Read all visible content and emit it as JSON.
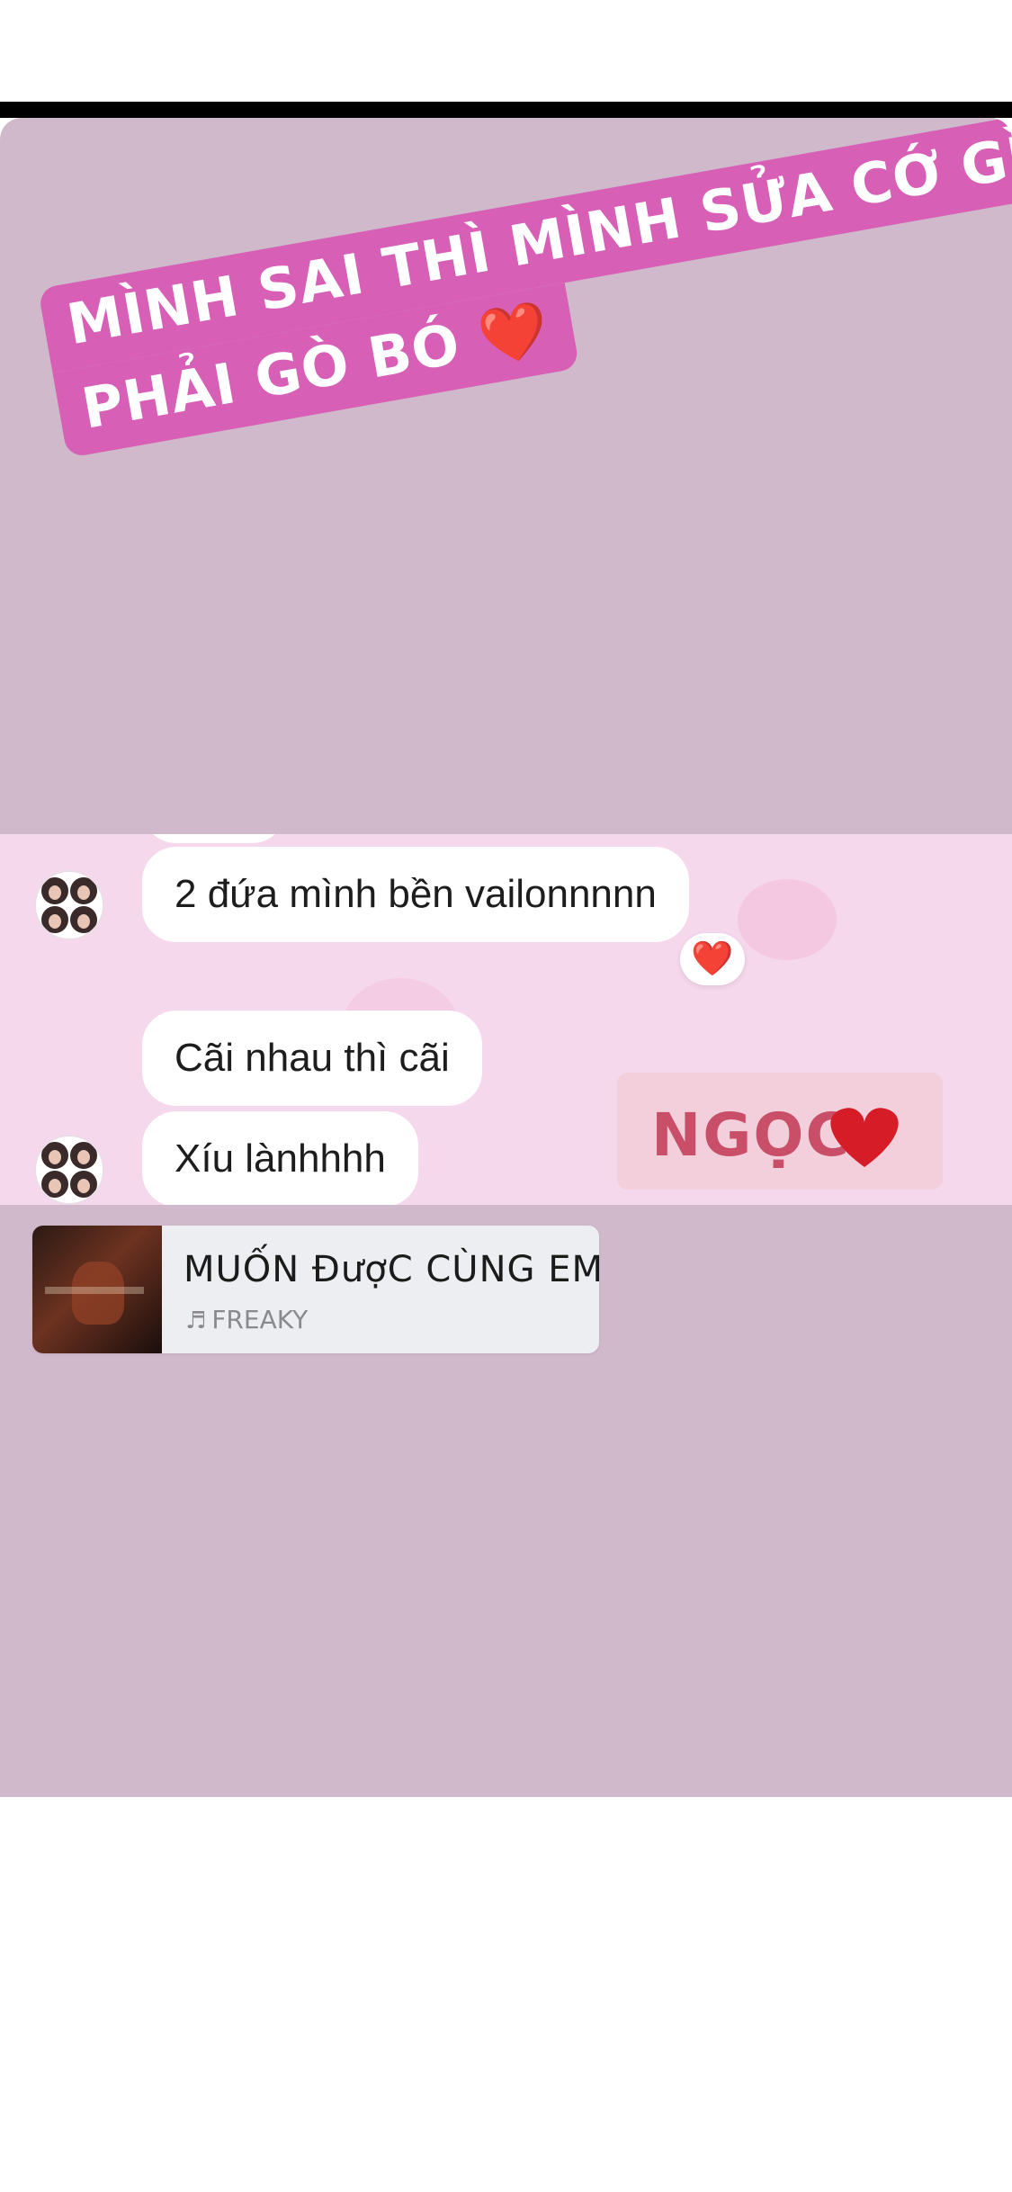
{
  "story": {
    "caption": {
      "line1": "MÌNH SAI THÌ MÌNH SỬA CỚ GÌ",
      "line2": "PHẢI GÒ BÓ ❤️"
    },
    "chat": {
      "messages": [
        {
          "text": "2 đứa mình bền vailonnnnn",
          "reaction": "❤️"
        },
        {
          "text": "Cãi nhau thì cãi"
        },
        {
          "text": "Xíu lànhhhh"
        }
      ]
    },
    "name_sticker": "NGỌC ❤️",
    "music": {
      "title": "MUỐN ĐượC CÙNG EM",
      "note_icon": "♬",
      "artist": "FREAKY"
    }
  }
}
